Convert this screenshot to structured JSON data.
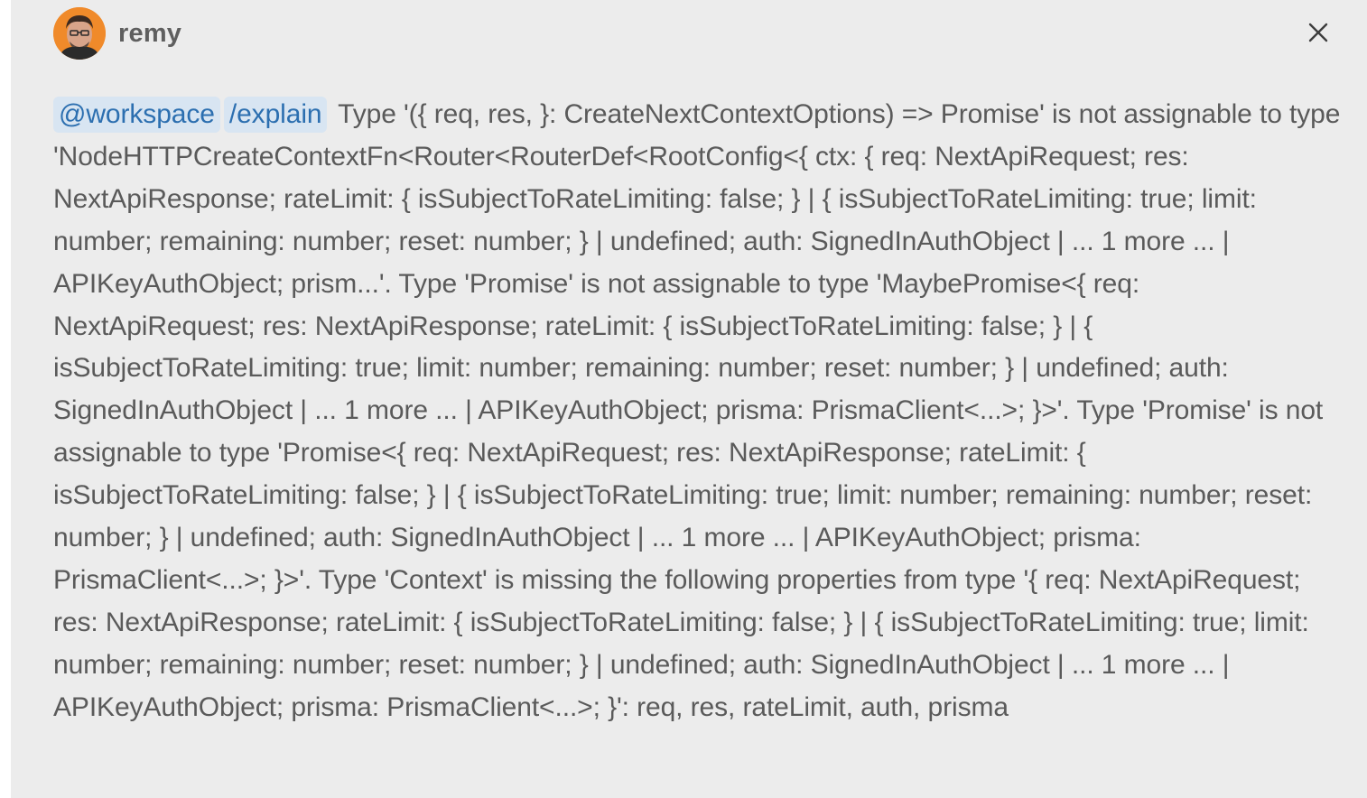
{
  "header": {
    "username": "remy",
    "avatar_icon": "avatar-icon",
    "close_icon": "close-icon"
  },
  "message": {
    "mention": "@workspace",
    "command": "/explain",
    "text": "Type '({ req, res, }: CreateNextContextOptions) => Promise' is not assignable to type 'NodeHTTPCreateContextFn<Router<RouterDef<RootConfig<{ ctx: { req: NextApiRequest; res: NextApiResponse; rateLimit: { isSubjectToRateLimiting: false; } | { isSubjectToRateLimiting: true; limit: number; remaining: number; reset: number; } | undefined; auth: SignedInAuthObject | ... 1 more ... | APIKeyAuthObject; prism...'. Type 'Promise' is not assignable to type 'MaybePromise<{ req: NextApiRequest; res: NextApiResponse; rateLimit: { isSubjectToRateLimiting: false; } | { isSubjectToRateLimiting: true; limit: number; remaining: number; reset: number; } | undefined; auth: SignedInAuthObject | ... 1 more ... | APIKeyAuthObject; prisma: PrismaClient<...>; }>'. Type 'Promise' is not assignable to type 'Promise<{ req: NextApiRequest; res: NextApiResponse; rateLimit: { isSubjectToRateLimiting: false; } | { isSubjectToRateLimiting: true; limit: number; remaining: number; reset: number; } | undefined; auth: SignedInAuthObject | ... 1 more ... | APIKeyAuthObject; prisma: PrismaClient<...>; }>'. Type 'Context' is missing the following properties from type '{ req: NextApiRequest; res: NextApiResponse; rateLimit: { isSubjectToRateLimiting: false; } | { isSubjectToRateLimiting: true; limit: number; remaining: number; reset: number; } | undefined; auth: SignedInAuthObject | ... 1 more ... | APIKeyAuthObject; prisma: PrismaClient<...>; }': req, res, rateLimit, auth, prisma"
  },
  "colors": {
    "panel_background": "#ececec",
    "chip_background": "#d8e5f2",
    "chip_text": "#2c6fb0",
    "body_text": "#5a5a5a",
    "avatar_background": "#f08a2a"
  }
}
